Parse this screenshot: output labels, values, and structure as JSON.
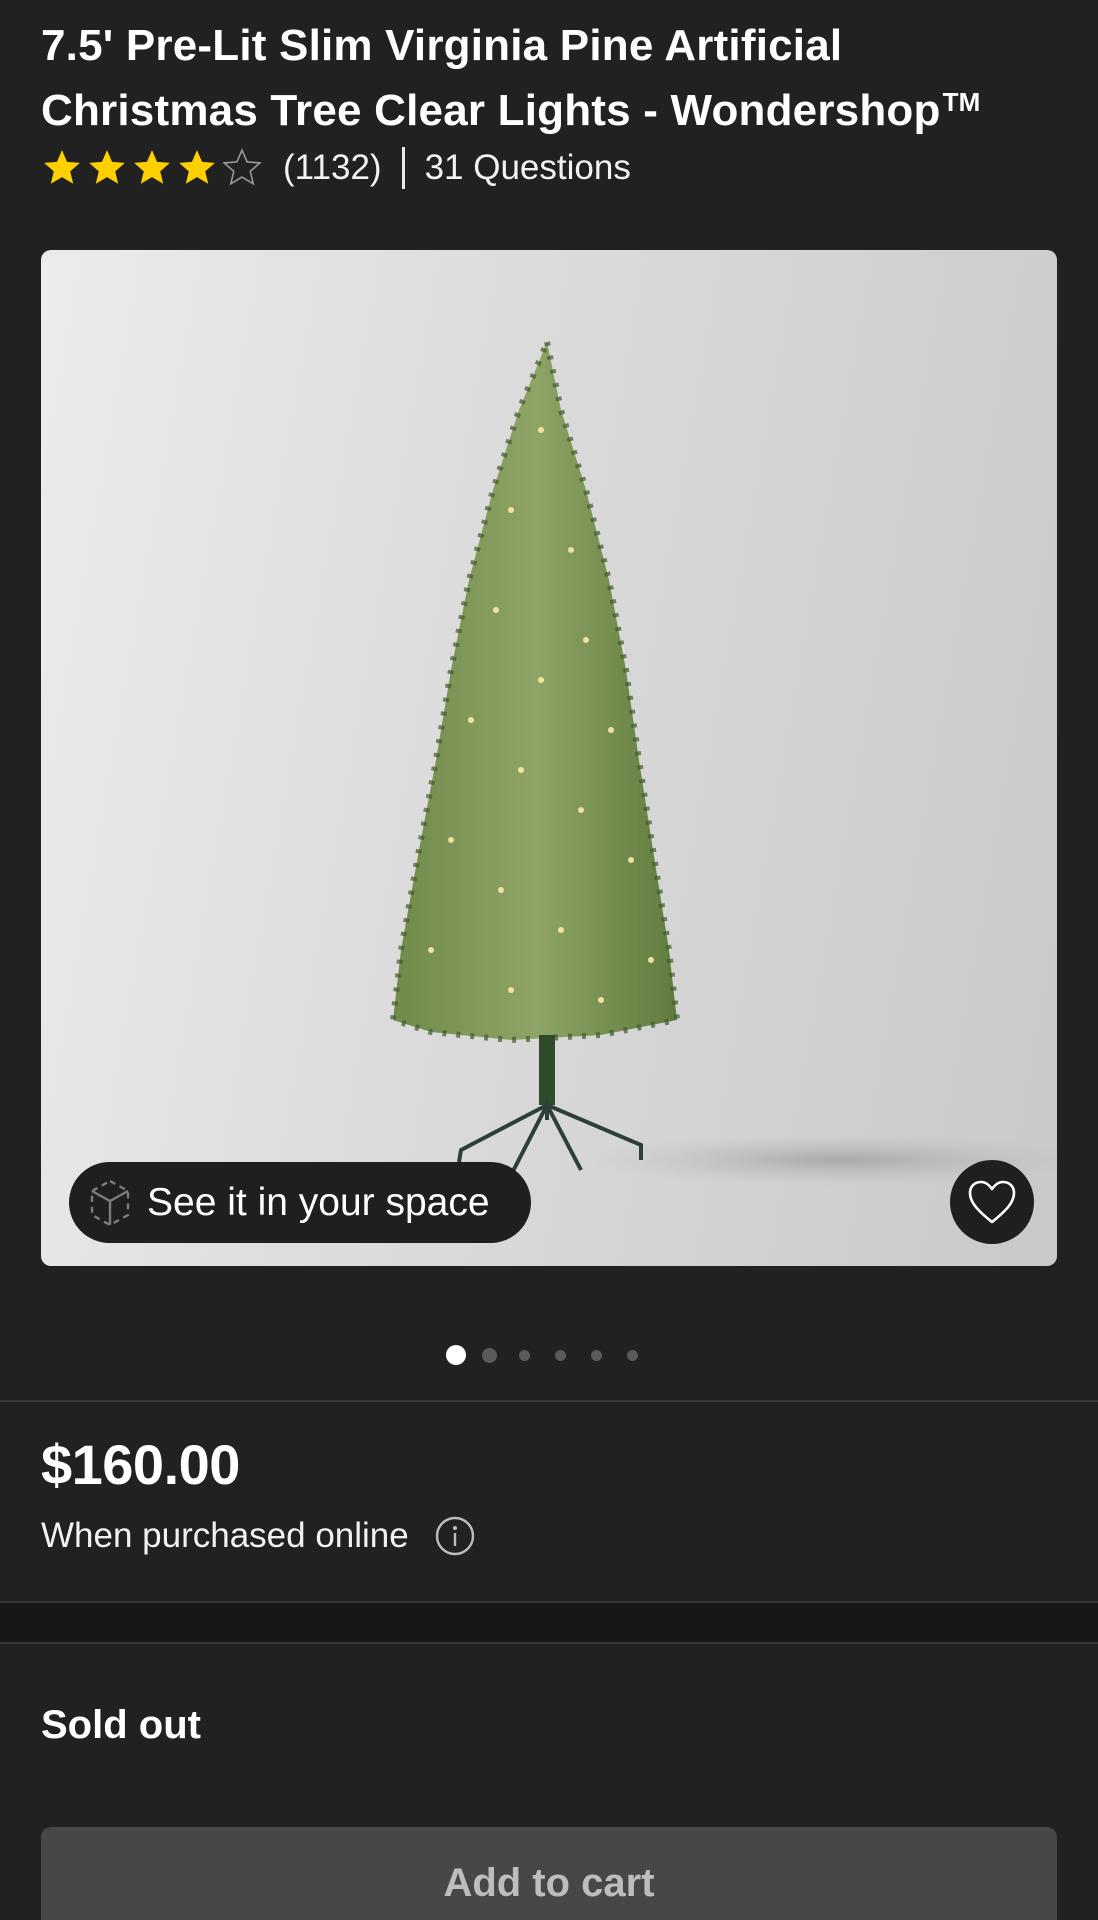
{
  "product": {
    "title": "7.5' Pre-Lit Slim Virginia Pine Artificial Christmas Tree Clear Lights - Wondershop",
    "trademark": "TM",
    "rating": 4,
    "rating_max": 5,
    "rating_count": "(1132)",
    "questions_label": "31 Questions"
  },
  "gallery": {
    "ar_button_label": "See it in your space",
    "ar_icon": "ar-cube-icon",
    "favorite_icon": "heart-icon",
    "image_count": 6,
    "active_index": 0
  },
  "pricing": {
    "price": "$160.00",
    "note": "When purchased online",
    "info_icon": "info-icon"
  },
  "fulfillment": {
    "status": "Sold out"
  },
  "cart": {
    "add_label": "Add to cart"
  },
  "colors": {
    "background": "#212121",
    "star": "#ffd000",
    "disabled_button": "#474747"
  }
}
